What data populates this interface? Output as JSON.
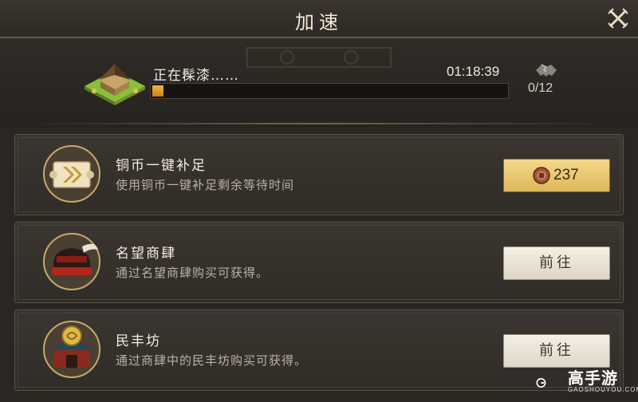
{
  "header": {
    "title": "加速",
    "close_icon": "close-x-icon"
  },
  "progress": {
    "status_label": "正在髹漆……",
    "timer": "01:18:39",
    "fraction": 0.03,
    "help_icon": "handshake-icon",
    "help_count": "0/12",
    "fill_color": "#e6a12c"
  },
  "options": [
    {
      "title": "铜币一键补足",
      "desc": "使用铜币一键补足剩余等待时间",
      "icon": "scroll-arrow-icon",
      "button_icon": "copper-coin-icon",
      "button_value": "237",
      "button_color": "#e8c874"
    },
    {
      "title": "名望商肆",
      "desc": "通过名望商肆购买可获得。",
      "icon": "official-hat-icon",
      "button_label": "前往"
    },
    {
      "title": "民丰坊",
      "desc": "通过商肆中的民丰坊购买可获得。",
      "icon": "market-gate-icon",
      "button_label": "前往"
    }
  ],
  "watermark": {
    "name": "高手游",
    "sub": "GAOSHOUYOU.COM"
  }
}
